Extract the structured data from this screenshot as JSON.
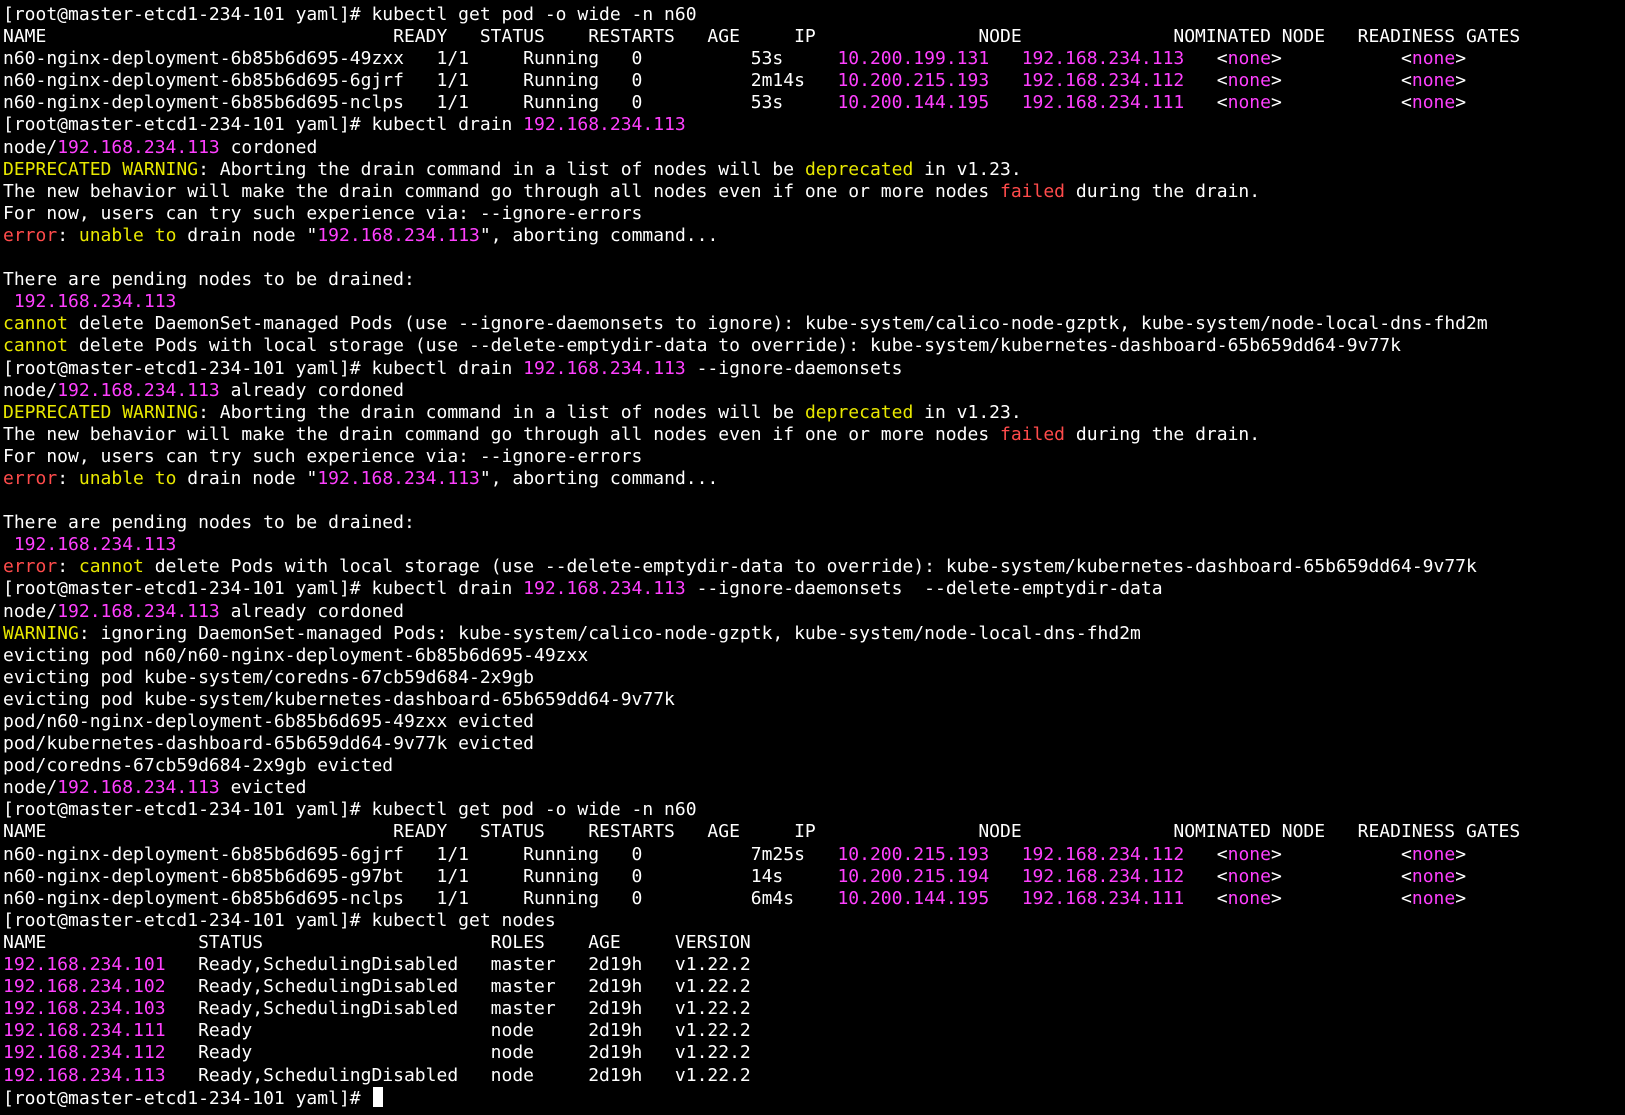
{
  "colors": {
    "w": "#ffffff",
    "m": "#ff40ff",
    "y": "#e8e800",
    "r": "#ff4b4b",
    "background": "#000000"
  },
  "cursor_icon": "block-cursor",
  "lines": [
    [
      [
        "w",
        "[root@master-etcd1-234-101 yaml]# kubectl get pod -o wide -n n60"
      ]
    ],
    [
      [
        "w",
        "NAME                                READY   STATUS    RESTARTS   AGE     IP               NODE              NOMINATED NODE   READINESS GATES"
      ]
    ],
    [
      [
        "w",
        "n60-nginx-deployment-6b85b6d695-49zxx   1/1     Running   0          53s     "
      ],
      [
        "m",
        "10.200.199.131"
      ],
      [
        "w",
        "   "
      ],
      [
        "m",
        "192.168.234.113"
      ],
      [
        "w",
        "   <"
      ],
      [
        "m",
        "none"
      ],
      [
        "w",
        ">           <"
      ],
      [
        "m",
        "none"
      ],
      [
        "w",
        ">"
      ]
    ],
    [
      [
        "w",
        "n60-nginx-deployment-6b85b6d695-6gjrf   1/1     Running   0          2m14s   "
      ],
      [
        "m",
        "10.200.215.193"
      ],
      [
        "w",
        "   "
      ],
      [
        "m",
        "192.168.234.112"
      ],
      [
        "w",
        "   <"
      ],
      [
        "m",
        "none"
      ],
      [
        "w",
        ">           <"
      ],
      [
        "m",
        "none"
      ],
      [
        "w",
        ">"
      ]
    ],
    [
      [
        "w",
        "n60-nginx-deployment-6b85b6d695-nclps   1/1     Running   0          53s     "
      ],
      [
        "m",
        "10.200.144.195"
      ],
      [
        "w",
        "   "
      ],
      [
        "m",
        "192.168.234.111"
      ],
      [
        "w",
        "   <"
      ],
      [
        "m",
        "none"
      ],
      [
        "w",
        ">           <"
      ],
      [
        "m",
        "none"
      ],
      [
        "w",
        ">"
      ]
    ],
    [
      [
        "w",
        "[root@master-etcd1-234-101 yaml]# kubectl drain "
      ],
      [
        "m",
        "192.168.234.113"
      ]
    ],
    [
      [
        "w",
        "node/"
      ],
      [
        "m",
        "192.168.234.113"
      ],
      [
        "w",
        " cordoned"
      ]
    ],
    [
      [
        "y",
        "DEPRECATED WARNING"
      ],
      [
        "w",
        ": Aborting the drain command in a list of nodes will be "
      ],
      [
        "y",
        "deprecated"
      ],
      [
        "w",
        " in v1.23."
      ]
    ],
    [
      [
        "w",
        "The new behavior will make the drain command go through all nodes even if one or more nodes "
      ],
      [
        "r",
        "failed"
      ],
      [
        "w",
        " during the drain."
      ]
    ],
    [
      [
        "w",
        "For now, users can try such experience via: --ignore-errors"
      ]
    ],
    [
      [
        "r",
        "error"
      ],
      [
        "w",
        ": "
      ],
      [
        "y",
        "unable to"
      ],
      [
        "w",
        " drain node \""
      ],
      [
        "m",
        "192.168.234.113"
      ],
      [
        "w",
        "\", aborting command..."
      ]
    ],
    [
      [
        "w",
        ""
      ]
    ],
    [
      [
        "w",
        "There are pending nodes to be drained:"
      ]
    ],
    [
      [
        "w",
        " "
      ],
      [
        "m",
        "192.168.234.113"
      ]
    ],
    [
      [
        "y",
        "cannot"
      ],
      [
        "w",
        " delete DaemonSet-managed Pods (use --ignore-daemonsets to ignore): kube-system/calico-node-gzptk, kube-system/node-local-dns-fhd2m"
      ]
    ],
    [
      [
        "y",
        "cannot"
      ],
      [
        "w",
        " delete Pods with local storage (use --delete-emptydir-data to override): kube-system/kubernetes-dashboard-65b659dd64-9v77k"
      ]
    ],
    [
      [
        "w",
        "[root@master-etcd1-234-101 yaml]# kubectl drain "
      ],
      [
        "m",
        "192.168.234.113"
      ],
      [
        "w",
        " --ignore-daemonsets"
      ]
    ],
    [
      [
        "w",
        "node/"
      ],
      [
        "m",
        "192.168.234.113"
      ],
      [
        "w",
        " already cordoned"
      ]
    ],
    [
      [
        "y",
        "DEPRECATED WARNING"
      ],
      [
        "w",
        ": Aborting the drain command in a list of nodes will be "
      ],
      [
        "y",
        "deprecated"
      ],
      [
        "w",
        " in v1.23."
      ]
    ],
    [
      [
        "w",
        "The new behavior will make the drain command go through all nodes even if one or more nodes "
      ],
      [
        "r",
        "failed"
      ],
      [
        "w",
        " during the drain."
      ]
    ],
    [
      [
        "w",
        "For now, users can try such experience via: --ignore-errors"
      ]
    ],
    [
      [
        "r",
        "error"
      ],
      [
        "w",
        ": "
      ],
      [
        "y",
        "unable to"
      ],
      [
        "w",
        " drain node \""
      ],
      [
        "m",
        "192.168.234.113"
      ],
      [
        "w",
        "\", aborting command..."
      ]
    ],
    [
      [
        "w",
        ""
      ]
    ],
    [
      [
        "w",
        "There are pending nodes to be drained:"
      ]
    ],
    [
      [
        "w",
        " "
      ],
      [
        "m",
        "192.168.234.113"
      ]
    ],
    [
      [
        "r",
        "error"
      ],
      [
        "w",
        ": "
      ],
      [
        "y",
        "cannot"
      ],
      [
        "w",
        " delete Pods with local storage (use --delete-emptydir-data to override): kube-system/kubernetes-dashboard-65b659dd64-9v77k"
      ]
    ],
    [
      [
        "w",
        "[root@master-etcd1-234-101 yaml]# kubectl drain "
      ],
      [
        "m",
        "192.168.234.113"
      ],
      [
        "w",
        " --ignore-daemonsets  --delete-emptydir-data"
      ]
    ],
    [
      [
        "w",
        "node/"
      ],
      [
        "m",
        "192.168.234.113"
      ],
      [
        "w",
        " already cordoned"
      ]
    ],
    [
      [
        "y",
        "WARNING"
      ],
      [
        "w",
        ": ignoring DaemonSet-managed Pods: kube-system/calico-node-gzptk, kube-system/node-local-dns-fhd2m"
      ]
    ],
    [
      [
        "w",
        "evicting pod n60/n60-nginx-deployment-6b85b6d695-49zxx"
      ]
    ],
    [
      [
        "w",
        "evicting pod kube-system/coredns-67cb59d684-2x9gb"
      ]
    ],
    [
      [
        "w",
        "evicting pod kube-system/kubernetes-dashboard-65b659dd64-9v77k"
      ]
    ],
    [
      [
        "w",
        "pod/n60-nginx-deployment-6b85b6d695-49zxx evicted"
      ]
    ],
    [
      [
        "w",
        "pod/kubernetes-dashboard-65b659dd64-9v77k evicted"
      ]
    ],
    [
      [
        "w",
        "pod/coredns-67cb59d684-2x9gb evicted"
      ]
    ],
    [
      [
        "w",
        "node/"
      ],
      [
        "m",
        "192.168.234.113"
      ],
      [
        "w",
        " evicted"
      ]
    ],
    [
      [
        "w",
        "[root@master-etcd1-234-101 yaml]# kubectl get pod -o wide -n n60"
      ]
    ],
    [
      [
        "w",
        "NAME                                READY   STATUS    RESTARTS   AGE     IP               NODE              NOMINATED NODE   READINESS GATES"
      ]
    ],
    [
      [
        "w",
        "n60-nginx-deployment-6b85b6d695-6gjrf   1/1     Running   0          7m25s   "
      ],
      [
        "m",
        "10.200.215.193"
      ],
      [
        "w",
        "   "
      ],
      [
        "m",
        "192.168.234.112"
      ],
      [
        "w",
        "   <"
      ],
      [
        "m",
        "none"
      ],
      [
        "w",
        ">           <"
      ],
      [
        "m",
        "none"
      ],
      [
        "w",
        ">"
      ]
    ],
    [
      [
        "w",
        "n60-nginx-deployment-6b85b6d695-g97bt   1/1     Running   0          14s     "
      ],
      [
        "m",
        "10.200.215.194"
      ],
      [
        "w",
        "   "
      ],
      [
        "m",
        "192.168.234.112"
      ],
      [
        "w",
        "   <"
      ],
      [
        "m",
        "none"
      ],
      [
        "w",
        ">           <"
      ],
      [
        "m",
        "none"
      ],
      [
        "w",
        ">"
      ]
    ],
    [
      [
        "w",
        "n60-nginx-deployment-6b85b6d695-nclps   1/1     Running   0          6m4s    "
      ],
      [
        "m",
        "10.200.144.195"
      ],
      [
        "w",
        "   "
      ],
      [
        "m",
        "192.168.234.111"
      ],
      [
        "w",
        "   <"
      ],
      [
        "m",
        "none"
      ],
      [
        "w",
        ">           <"
      ],
      [
        "m",
        "none"
      ],
      [
        "w",
        ">"
      ]
    ],
    [
      [
        "w",
        "[root@master-etcd1-234-101 yaml]# kubectl get nodes"
      ]
    ],
    [
      [
        "w",
        "NAME              STATUS                     ROLES    AGE     VERSION"
      ]
    ],
    [
      [
        "m",
        "192.168.234.101"
      ],
      [
        "w",
        "   Ready,SchedulingDisabled   master   2d19h   v1.22.2"
      ]
    ],
    [
      [
        "m",
        "192.168.234.102"
      ],
      [
        "w",
        "   Ready,SchedulingDisabled   master   2d19h   v1.22.2"
      ]
    ],
    [
      [
        "m",
        "192.168.234.103"
      ],
      [
        "w",
        "   Ready,SchedulingDisabled   master   2d19h   v1.22.2"
      ]
    ],
    [
      [
        "m",
        "192.168.234.111"
      ],
      [
        "w",
        "   Ready                      node     2d19h   v1.22.2"
      ]
    ],
    [
      [
        "m",
        "192.168.234.112"
      ],
      [
        "w",
        "   Ready                      node     2d19h   v1.22.2"
      ]
    ],
    [
      [
        "m",
        "192.168.234.113"
      ],
      [
        "w",
        "   Ready,SchedulingDisabled   node     2d19h   v1.22.2"
      ]
    ],
    [
      [
        "w",
        "[root@master-etcd1-234-101 yaml]# "
      ]
    ]
  ]
}
